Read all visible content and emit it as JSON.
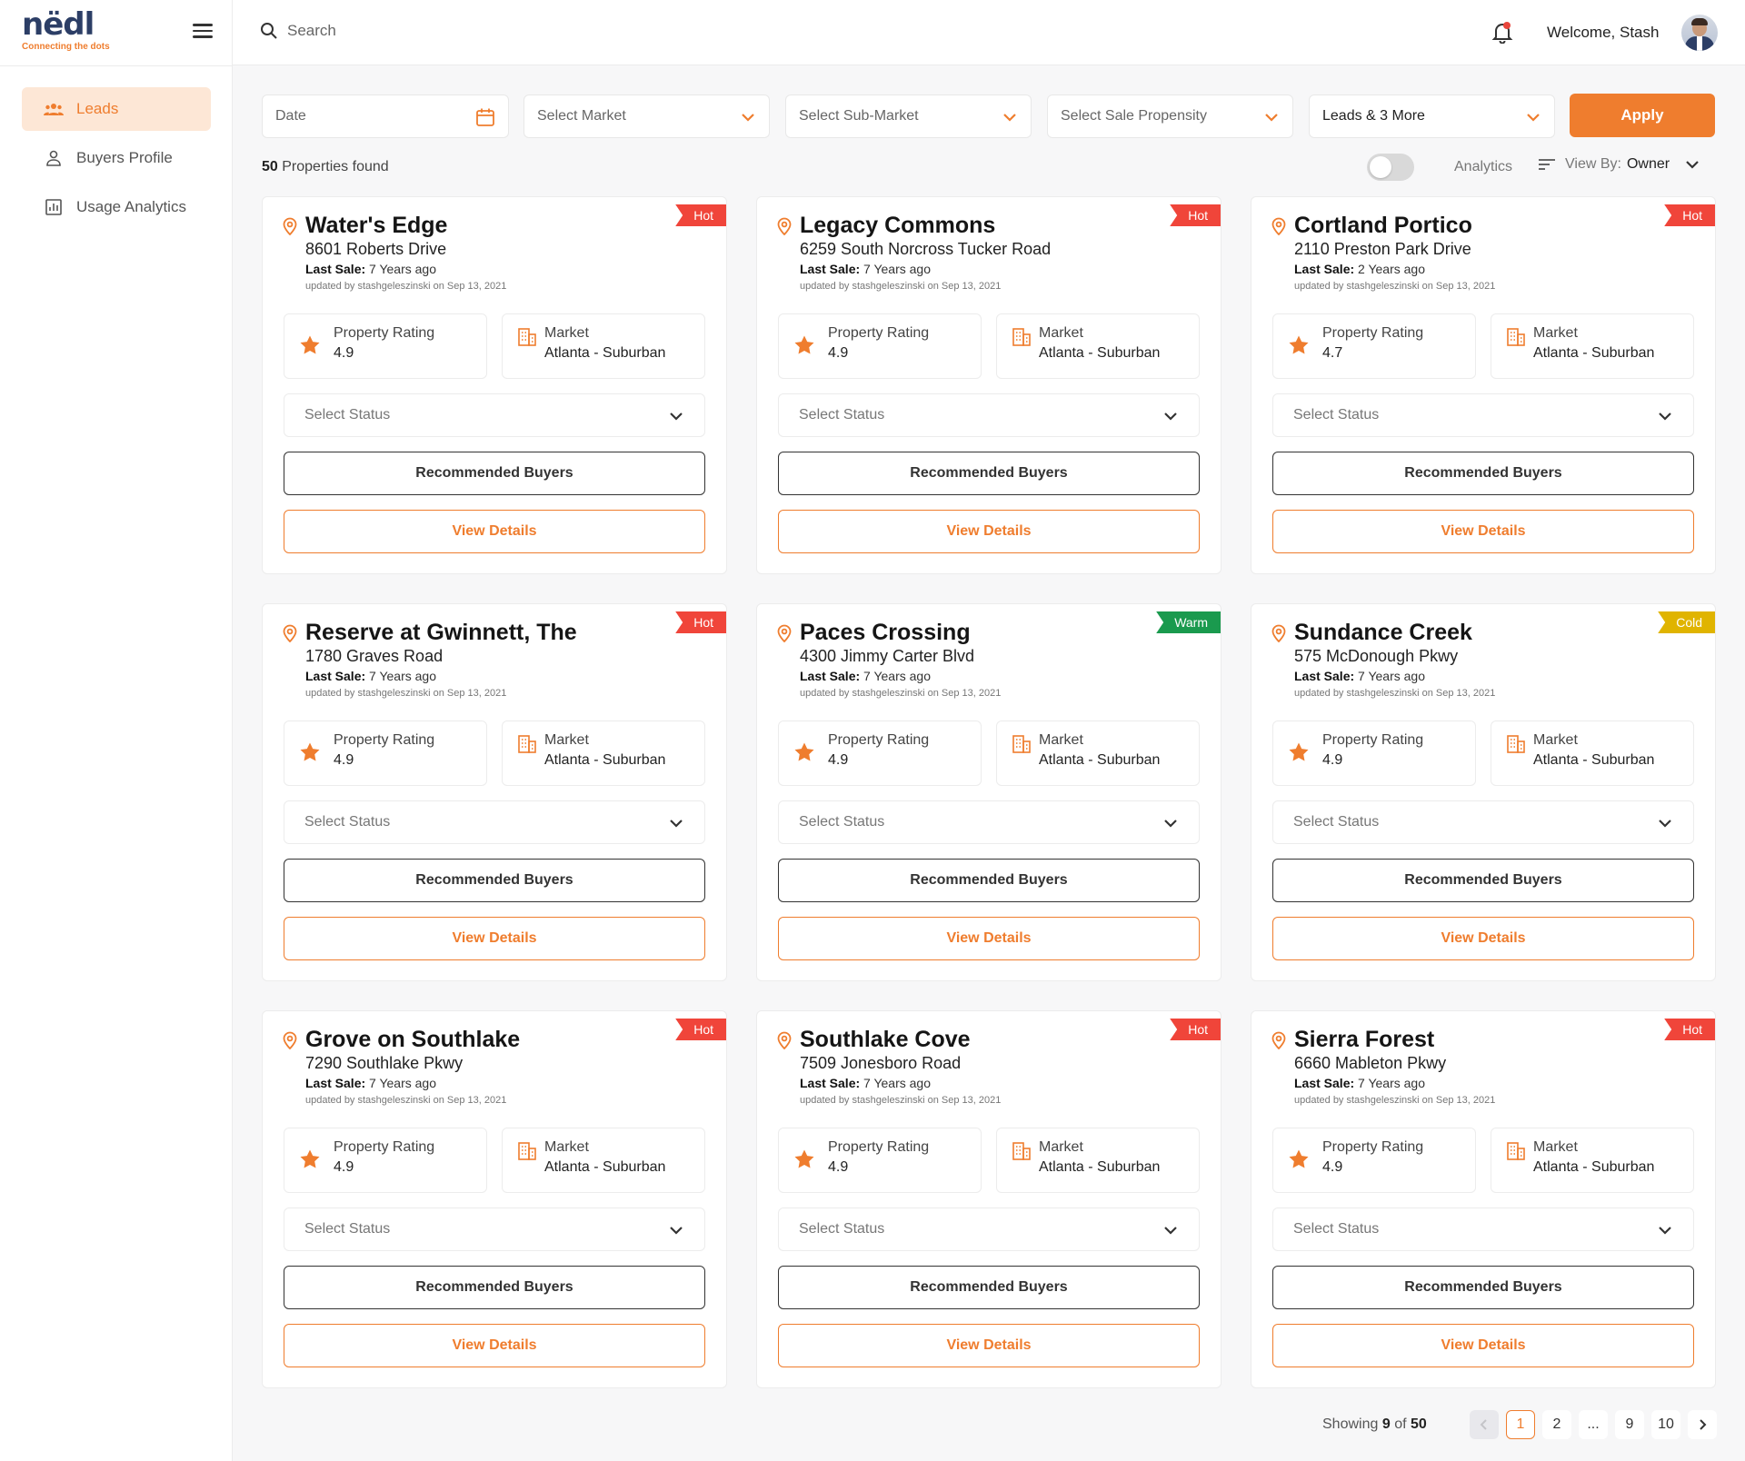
{
  "brand": {
    "name": "nëdl",
    "tagline": "Connecting the dots"
  },
  "colors": {
    "accent": "#ef7d2e",
    "hot": "#f0453a",
    "warm": "#1a9a4e",
    "cold": "#e0b400"
  },
  "sidebar": {
    "items": [
      {
        "label": "Leads",
        "icon": "users-icon",
        "active": true
      },
      {
        "label": "Buyers Profile",
        "icon": "user-icon",
        "active": false
      },
      {
        "label": "Usage Analytics",
        "icon": "chart-icon",
        "active": false
      }
    ]
  },
  "header": {
    "search_placeholder": "Search",
    "welcome": "Welcome, Stash"
  },
  "filters": {
    "date": "Date",
    "market": "Select Market",
    "submarket": "Select Sub-Market",
    "propensity": "Select Sale Propensity",
    "leads": "Leads & 3 More",
    "apply": "Apply"
  },
  "results": {
    "count": "50",
    "found_suffix": "Properties found"
  },
  "analytics_label": "Analytics",
  "view_by": {
    "label": "View By:",
    "value": "Owner"
  },
  "card_labels": {
    "rating": "Property Rating",
    "market": "Market",
    "last_sale": "Last Sale:",
    "status_placeholder": "Select Status",
    "recommended": "Recommended Buyers",
    "details": "View Details"
  },
  "properties": [
    {
      "name": "Water's Edge",
      "address": "8601 Roberts Drive",
      "last_sale": "7 Years ago",
      "updated": "updated by stashgeleszinski on Sep 13, 2021",
      "rating": "4.9",
      "market": "Atlanta - Suburban",
      "tag": "Hot"
    },
    {
      "name": "Legacy Commons",
      "address": "6259 South Norcross Tucker Road",
      "last_sale": "7 Years ago",
      "updated": "updated by stashgeleszinski on Sep 13, 2021",
      "rating": "4.9",
      "market": "Atlanta - Suburban",
      "tag": "Hot"
    },
    {
      "name": "Cortland Portico",
      "address": "2110 Preston Park Drive",
      "last_sale": "2 Years ago",
      "updated": "updated by stashgeleszinski on Sep 13, 2021",
      "rating": "4.7",
      "market": "Atlanta - Suburban",
      "tag": "Hot"
    },
    {
      "name": "Reserve at Gwinnett, The",
      "address": "1780 Graves Road",
      "last_sale": "7 Years ago",
      "updated": "updated by stashgeleszinski on Sep 13, 2021",
      "rating": "4.9",
      "market": "Atlanta - Suburban",
      "tag": "Hot"
    },
    {
      "name": "Paces Crossing",
      "address": "4300 Jimmy Carter Blvd",
      "last_sale": "7 Years ago",
      "updated": "updated by stashgeleszinski on Sep 13, 2021",
      "rating": "4.9",
      "market": "Atlanta - Suburban",
      "tag": "Warm"
    },
    {
      "name": "Sundance Creek",
      "address": "575 McDonough Pkwy",
      "last_sale": "7 Years ago",
      "updated": "updated by stashgeleszinski on Sep 13, 2021",
      "rating": "4.9",
      "market": "Atlanta - Suburban",
      "tag": "Cold"
    },
    {
      "name": "Grove on Southlake",
      "address": "7290 Southlake Pkwy",
      "last_sale": "7 Years ago",
      "updated": "updated by stashgeleszinski on Sep 13, 2021",
      "rating": "4.9",
      "market": "Atlanta - Suburban",
      "tag": "Hot"
    },
    {
      "name": "Southlake Cove",
      "address": "7509 Jonesboro Road",
      "last_sale": "7 Years ago",
      "updated": "updated by stashgeleszinski on Sep 13, 2021",
      "rating": "4.9",
      "market": "Atlanta - Suburban",
      "tag": "Hot"
    },
    {
      "name": "Sierra Forest",
      "address": "6660 Mableton Pkwy",
      "last_sale": "7 Years ago",
      "updated": "updated by stashgeleszinski on Sep 13, 2021",
      "rating": "4.9",
      "market": "Atlanta - Suburban",
      "tag": "Hot"
    }
  ],
  "pagination": {
    "showing_prefix": "Showing",
    "shown": "9",
    "of": "of",
    "total": "50",
    "pages": [
      "1",
      "2",
      "...",
      "9",
      "10"
    ],
    "current": "1"
  }
}
